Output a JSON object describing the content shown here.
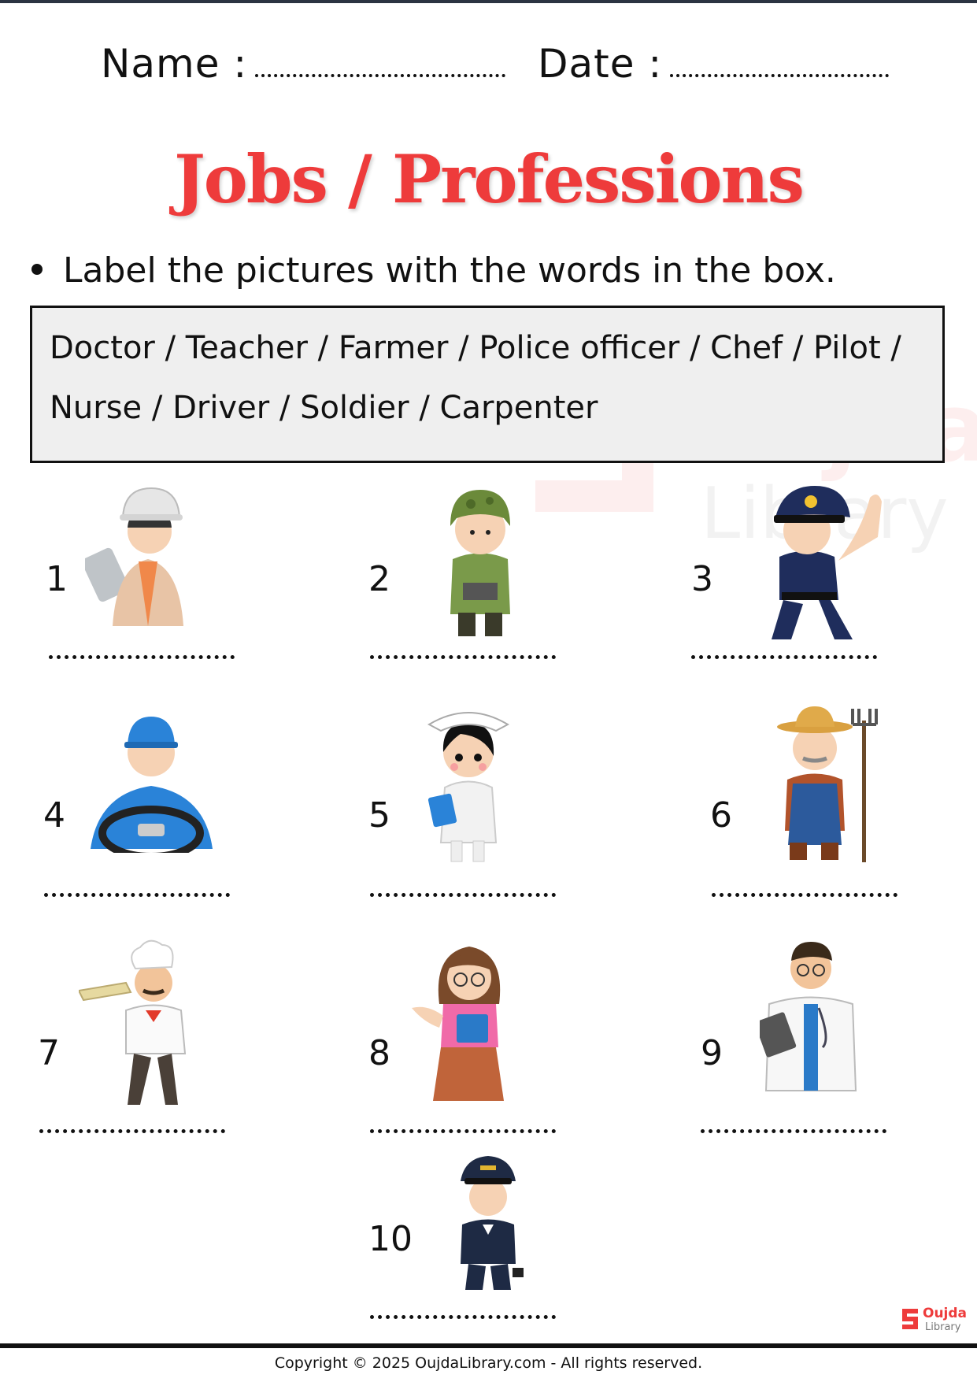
{
  "header": {
    "name_label": "Name :",
    "date_label": "Date :"
  },
  "title": "Jobs / Professions",
  "instruction": "Label the pictures with the words in the box.",
  "word_box": {
    "line1": "Doctor / Teacher / Farmer / Police officer / Chef / Pilot /",
    "line2": "Nurse / Driver / Soldier / Carpenter"
  },
  "items": [
    {
      "number": "1",
      "icon": "carpenter-icon"
    },
    {
      "number": "2",
      "icon": "soldier-icon"
    },
    {
      "number": "3",
      "icon": "police-officer-icon"
    },
    {
      "number": "4",
      "icon": "driver-icon"
    },
    {
      "number": "5",
      "icon": "nurse-icon"
    },
    {
      "number": "6",
      "icon": "farmer-icon"
    },
    {
      "number": "7",
      "icon": "chef-icon"
    },
    {
      "number": "8",
      "icon": "teacher-icon"
    },
    {
      "number": "9",
      "icon": "doctor-icon"
    },
    {
      "number": "10",
      "icon": "pilot-icon"
    }
  ],
  "logo": {
    "name": "Oujda",
    "sub": "Library"
  },
  "footer": {
    "copyright": "Copyright © 2025 OujdaLibrary.com - All rights reserved."
  },
  "colors": {
    "title": "#ee3b3b",
    "box_bg": "#efefef",
    "border": "#111111"
  }
}
